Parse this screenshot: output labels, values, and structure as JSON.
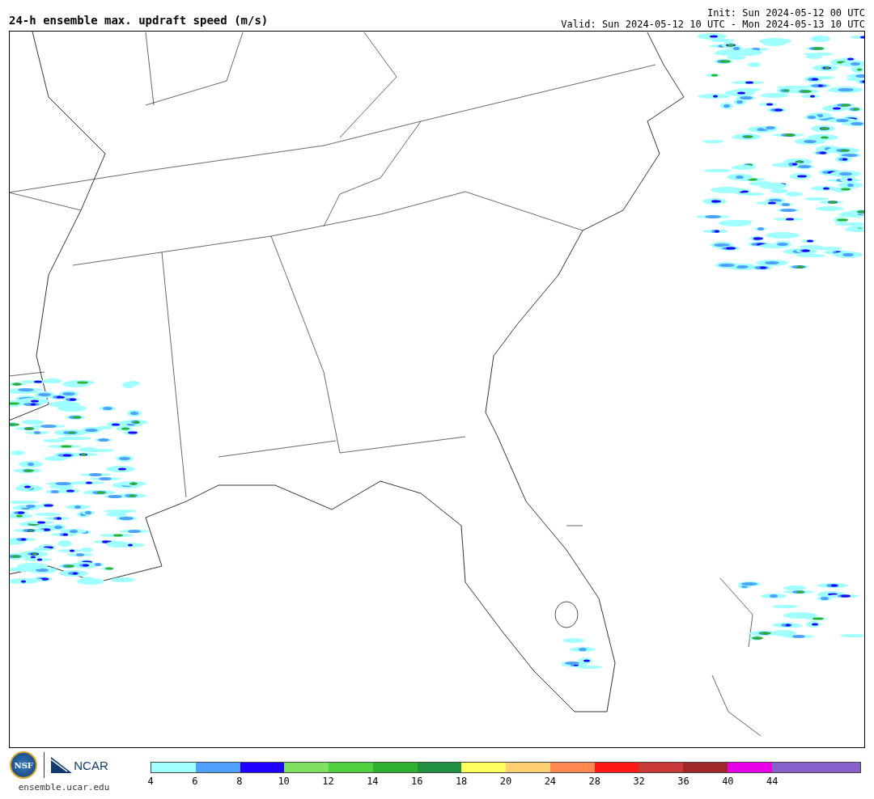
{
  "header": {
    "title": "24-h ensemble max. updraft speed (m/s)",
    "init": "Init: Sun 2024-05-12 00 UTC",
    "valid": "Valid: Sun 2024-05-12 10 UTC - Mon 2024-05-13 10 UTC"
  },
  "logos": {
    "nsf": "NSF",
    "ncar": "NCAR",
    "url": "ensemble.ucar.edu"
  },
  "colorbar": [
    {
      "color": "#a0ffff",
      "label": "4"
    },
    {
      "color": "#50a0ff",
      "label": "6"
    },
    {
      "color": "#2000ff",
      "label": "8"
    },
    {
      "color": "#80e060",
      "label": "10"
    },
    {
      "color": "#50d040",
      "label": "12"
    },
    {
      "color": "#30b030",
      "label": "14"
    },
    {
      "color": "#209040",
      "label": "16"
    },
    {
      "color": "#ffff60",
      "label": "18"
    },
    {
      "color": "#ffd070",
      "label": "20"
    },
    {
      "color": "#ff8850",
      "label": "24"
    },
    {
      "color": "#ff1818",
      "label": "28"
    },
    {
      "color": "#c83838",
      "label": "32"
    },
    {
      "color": "#a02828",
      "label": "36"
    },
    {
      "color": "#e800e8",
      "label": "40"
    },
    {
      "color": "#8860cc",
      "label": "44"
    },
    {
      "color": "#8860cc"
    }
  ]
}
